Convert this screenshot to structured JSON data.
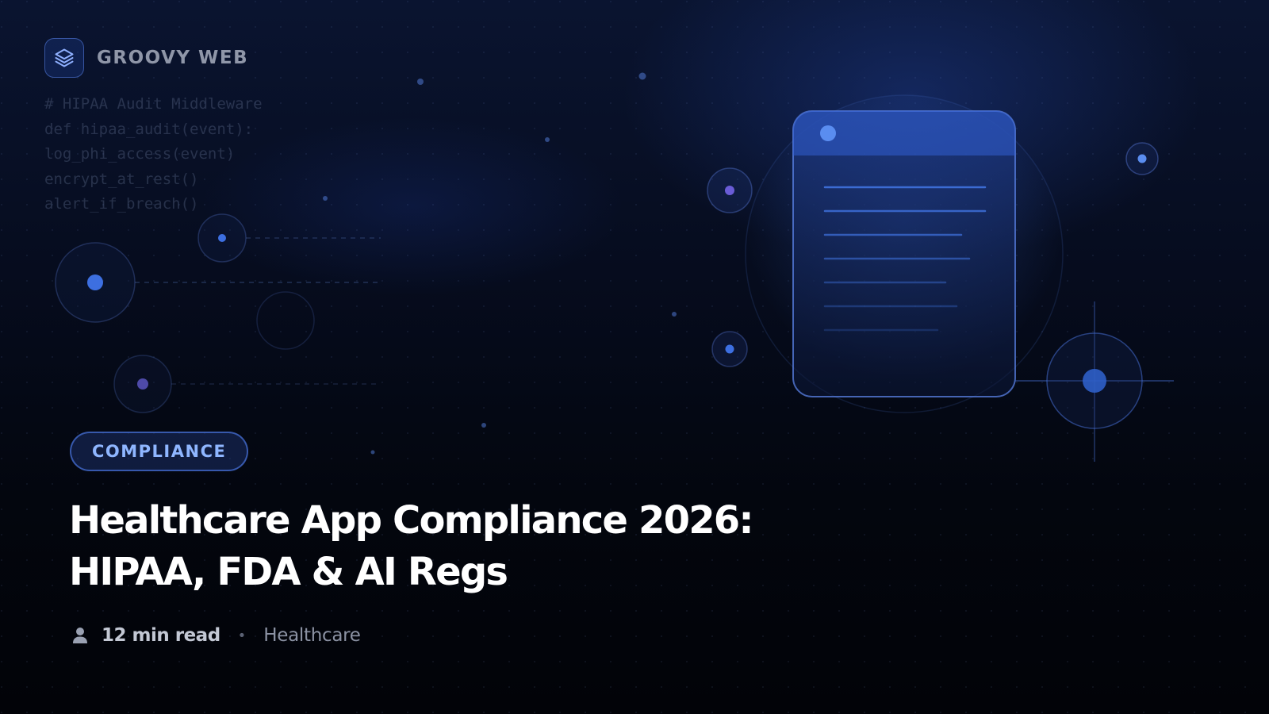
{
  "brand": {
    "name": "GROOVY WEB",
    "logo_icon": "layers-icon",
    "accent": "#4a7de8"
  },
  "code_snippet": [
    "# HIPAA Audit Middleware",
    "def hipaa_audit(event):",
    "log_phi_access(event)",
    "encrypt_at_rest()",
    "alert_if_breach()"
  ],
  "badge": {
    "label": "COMPLIANCE",
    "color": "#8fb6ff"
  },
  "headline": {
    "line1": "Healthcare App Compliance 2026:",
    "line2": "HIPAA, FDA & AI Regs"
  },
  "meta": {
    "author_icon": "person-icon",
    "read_time": "12 min read",
    "separator": "•",
    "category": "Healthcare"
  },
  "illustration": {
    "document_icon": "document-icon",
    "crosshair_icon": "crosshair-icon"
  }
}
